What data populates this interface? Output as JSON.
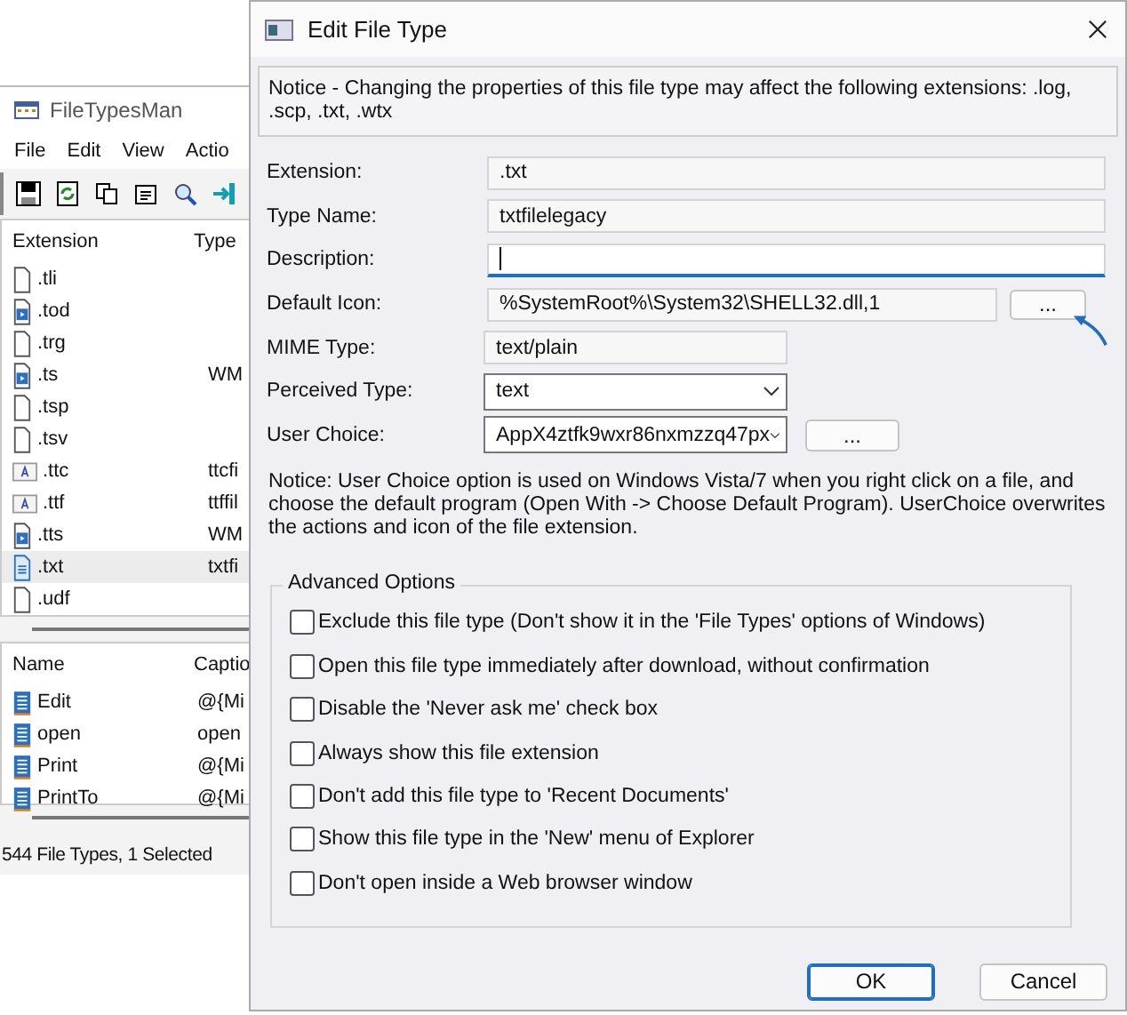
{
  "background_window": {
    "title": "FileTypesMan",
    "menu": [
      "File",
      "Edit",
      "View",
      "Actio"
    ],
    "toolbar": [
      {
        "kind": "save"
      },
      {
        "kind": "refresh"
      },
      {
        "kind": "copy"
      },
      {
        "kind": "properties"
      },
      {
        "kind": "search"
      },
      {
        "kind": "exit"
      }
    ],
    "extension_list": {
      "columns": [
        "Extension",
        "Type"
      ],
      "rows": [
        {
          "extension": ".tli",
          "kind": "blank",
          "selected": false
        },
        {
          "extension": ".tod",
          "kind": "media",
          "selected": false
        },
        {
          "extension": ".trg",
          "kind": "blank",
          "selected": false
        },
        {
          "extension": ".ts",
          "type": "WM",
          "kind": "media",
          "selected": false
        },
        {
          "extension": ".tsp",
          "kind": "blank",
          "selected": false
        },
        {
          "extension": ".tsv",
          "kind": "blank",
          "selected": false
        },
        {
          "extension": ".ttc",
          "type": "ttcfi",
          "kind": "font",
          "selected": false
        },
        {
          "extension": ".ttf",
          "type": "ttffil",
          "kind": "font",
          "selected": false
        },
        {
          "extension": ".tts",
          "type": "WM",
          "kind": "media",
          "selected": false
        },
        {
          "extension": ".txt",
          "type": "txtfi",
          "kind": "text",
          "selected": true
        },
        {
          "extension": ".udf",
          "kind": "blank",
          "selected": false
        }
      ]
    },
    "actions_list": {
      "columns": [
        "Name",
        "Captio"
      ],
      "rows": [
        {
          "name": "Edit",
          "caption": "@{Mi"
        },
        {
          "name": "open",
          "caption": "open"
        },
        {
          "name": "Print",
          "caption": "@{Mi"
        },
        {
          "name": "PrintTo",
          "caption": "@{Mi"
        }
      ]
    },
    "status_bar": "544 File Types, 1 Selected"
  },
  "dialog": {
    "title": "Edit File Type",
    "notice": "Notice - Changing the properties of this file type may affect the following extensions: .log, .scp, .txt, .wtx",
    "fields": [
      {
        "label": "Extension:",
        "value": ".txt",
        "kind": "readonly"
      },
      {
        "label": "Type Name:",
        "value": "txtfilelegacy",
        "kind": "readonly"
      },
      {
        "label": "Description:",
        "kind": "edit",
        "focused": true
      },
      {
        "label": "Default Icon:",
        "value": "%SystemRoot%\\System32\\SHELL32.dll,1",
        "kind": "browse",
        "button": "..."
      },
      {
        "label": "MIME Type:",
        "value": "text/plain",
        "kind": "short"
      },
      {
        "label": "Perceived Type:",
        "value": "text",
        "kind": "combo"
      },
      {
        "label": "User Choice:",
        "value": "AppX4ztfk9wxr86nxmzzq47px",
        "kind": "combo",
        "button": "..."
      }
    ],
    "user_choice_notice": "Notice: User Choice option is used on Windows Vista/7 when you right click on a file, and choose the default program (Open With -> Choose Default Program). UserChoice overwrites the actions and icon of the file extension.",
    "advanced_options": {
      "title": "Advanced Options",
      "options": [
        {
          "label": "Exclude  this file type (Don't show it in the 'File Types' options of Windows)",
          "checked": false
        },
        {
          "label": "Open this file type immediately after download, without confirmation",
          "checked": false
        },
        {
          "label": "Disable the 'Never ask me' check box",
          "checked": false
        },
        {
          "label": "Always show this file extension",
          "checked": false
        },
        {
          "label": "Don't add this file type to 'Recent Documents'",
          "checked": false
        },
        {
          "label": "Show this file type in the 'New' menu of Explorer",
          "checked": false
        },
        {
          "label": "Don't open inside a Web browser window",
          "checked": false
        }
      ]
    },
    "buttons": [
      {
        "label": "OK",
        "default": true
      },
      {
        "label": "Cancel",
        "default": false
      }
    ]
  }
}
